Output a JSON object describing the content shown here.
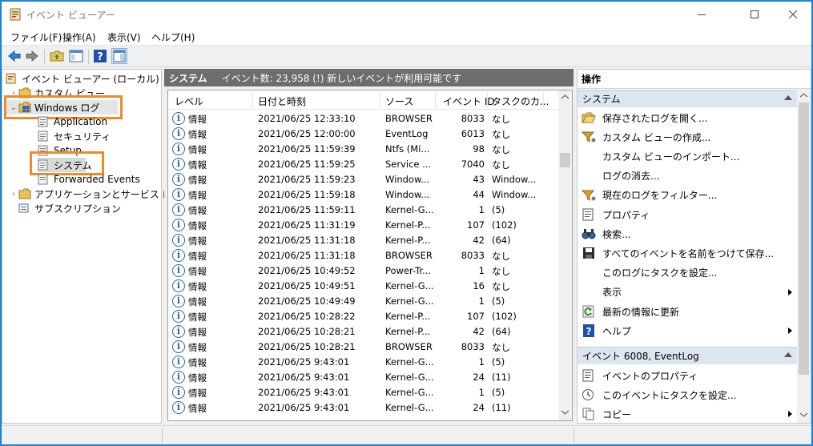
{
  "window": {
    "title": "イベント ビューアー"
  },
  "menu": [
    "ファイル(F)",
    "操作(A)",
    "表示(V)",
    "ヘルプ(H)"
  ],
  "tree": {
    "root": "イベント ビューアー (ローカル)",
    "custom_views": "カスタム ビュー",
    "windows_logs": "Windows ログ",
    "logs": [
      "Application",
      "セキュリティ",
      "Setup",
      "システム",
      "Forwarded Events"
    ],
    "app_services": "アプリケーションとサービス ログ",
    "subscriptions": "サブスクリプション"
  },
  "center": {
    "title": "システム",
    "info": "イベント数: 23,958 (!) 新しいイベントが利用可能です",
    "columns": [
      "レベル",
      "日付と時刻",
      "ソース",
      "イベント ID",
      "タスクのカ..."
    ],
    "rows": [
      {
        "level": "情報",
        "date": "2021/06/25 12:33:10",
        "source": "BROWSER",
        "id": "8033",
        "task": "なし"
      },
      {
        "level": "情報",
        "date": "2021/06/25 12:00:00",
        "source": "EventLog",
        "id": "6013",
        "task": "なし"
      },
      {
        "level": "情報",
        "date": "2021/06/25 11:59:39",
        "source": "Ntfs (Mi...",
        "id": "98",
        "task": "なし"
      },
      {
        "level": "情報",
        "date": "2021/06/25 11:59:25",
        "source": "Service ...",
        "id": "7040",
        "task": "なし"
      },
      {
        "level": "情報",
        "date": "2021/06/25 11:59:23",
        "source": "Window...",
        "id": "43",
        "task": "Window..."
      },
      {
        "level": "情報",
        "date": "2021/06/25 11:59:18",
        "source": "Window...",
        "id": "44",
        "task": "Window..."
      },
      {
        "level": "情報",
        "date": "2021/06/25 11:59:11",
        "source": "Kernel-G...",
        "id": "1",
        "task": "(5)"
      },
      {
        "level": "情報",
        "date": "2021/06/25 11:31:19",
        "source": "Kernel-P...",
        "id": "107",
        "task": "(102)"
      },
      {
        "level": "情報",
        "date": "2021/06/25 11:31:18",
        "source": "Kernel-P...",
        "id": "42",
        "task": "(64)"
      },
      {
        "level": "情報",
        "date": "2021/06/25 11:31:18",
        "source": "BROWSER",
        "id": "8033",
        "task": "なし"
      },
      {
        "level": "情報",
        "date": "2021/06/25 10:49:52",
        "source": "Power-Tr...",
        "id": "1",
        "task": "なし"
      },
      {
        "level": "情報",
        "date": "2021/06/25 10:49:51",
        "source": "Kernel-G...",
        "id": "16",
        "task": "なし"
      },
      {
        "level": "情報",
        "date": "2021/06/25 10:49:49",
        "source": "Kernel-G...",
        "id": "1",
        "task": "(5)"
      },
      {
        "level": "情報",
        "date": "2021/06/25 10:28:22",
        "source": "Kernel-P...",
        "id": "107",
        "task": "(102)"
      },
      {
        "level": "情報",
        "date": "2021/06/25 10:28:21",
        "source": "Kernel-P...",
        "id": "42",
        "task": "(64)"
      },
      {
        "level": "情報",
        "date": "2021/06/25 10:28:21",
        "source": "BROWSER",
        "id": "8033",
        "task": "なし"
      },
      {
        "level": "情報",
        "date": "2021/06/25 9:43:01",
        "source": "Kernel-G...",
        "id": "1",
        "task": "(5)"
      },
      {
        "level": "情報",
        "date": "2021/06/25 9:43:01",
        "source": "Kernel-G...",
        "id": "24",
        "task": "(11)"
      },
      {
        "level": "情報",
        "date": "2021/06/25 9:43:01",
        "source": "Kernel-G...",
        "id": "1",
        "task": "(5)"
      },
      {
        "level": "情報",
        "date": "2021/06/25 9:43:01",
        "source": "Kernel-G...",
        "id": "24",
        "task": "(11)"
      }
    ]
  },
  "actions": {
    "title": "操作",
    "section1": "システム",
    "items1": [
      {
        "label": "保存されたログを開く...",
        "icon": "folder-open-icon"
      },
      {
        "label": "カスタム ビューの作成...",
        "icon": "filter-icon"
      },
      {
        "label": "カスタム ビューのインポート...",
        "icon": ""
      },
      {
        "label": "ログの消去...",
        "icon": ""
      },
      {
        "label": "現在のログをフィルター...",
        "icon": "filter-icon"
      },
      {
        "label": "プロパティ",
        "icon": "properties-icon"
      },
      {
        "label": "検索...",
        "icon": "binoculars-icon"
      },
      {
        "label": "すべてのイベントを名前をつけて保存...",
        "icon": "save-icon"
      },
      {
        "label": "このログにタスクを設定...",
        "icon": ""
      },
      {
        "label": "表示",
        "icon": "",
        "submenu": true
      },
      {
        "label": "最新の情報に更新",
        "icon": "refresh-icon"
      },
      {
        "label": "ヘルプ",
        "icon": "help-icon",
        "submenu": true
      }
    ],
    "section2": "イベント 6008, EventLog",
    "items2": [
      {
        "label": "イベントのプロパティ",
        "icon": "properties-icon"
      },
      {
        "label": "このイベントにタスクを設定...",
        "icon": "task-icon"
      },
      {
        "label": "コピー",
        "icon": "copy-icon",
        "submenu": true
      }
    ]
  },
  "colors": {
    "highlight": "#f08a24",
    "section_bg": "#dce6f0",
    "header_bg": "#6d6d6d"
  }
}
